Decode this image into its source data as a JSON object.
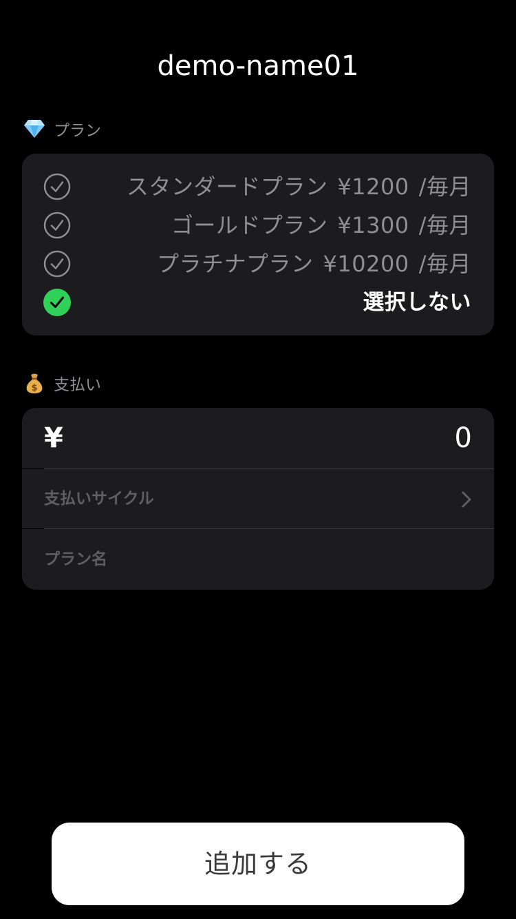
{
  "header": {
    "title": "demo-name01"
  },
  "plan_section": {
    "emoji": "💎",
    "emoji_icon": "diamond-icon",
    "title": "プラン",
    "plans": [
      {
        "name": "スタンダードプラン",
        "price": "¥1200",
        "period": "/毎月",
        "selected": false
      },
      {
        "name": "ゴールドプラン",
        "price": "¥1300",
        "period": "/毎月",
        "selected": false
      },
      {
        "name": "プラチナプラン",
        "price": "¥10200",
        "period": "/毎月",
        "selected": false
      },
      {
        "name": "選択しない",
        "price": "",
        "period": "",
        "selected": true
      }
    ]
  },
  "payment_section": {
    "emoji": "💰",
    "emoji_icon": "money-bag-icon",
    "title": "支払い",
    "currency_symbol": "¥",
    "amount": "0",
    "cycle_label": "支払いサイクル",
    "plan_name_placeholder": "プラン名"
  },
  "footer": {
    "add_button_label": "追加する"
  },
  "colors": {
    "background": "#000000",
    "card": "#1c1c1e",
    "muted_text": "#8e8e93",
    "selected_check": "#30d158",
    "button_bg": "#ffffff"
  }
}
